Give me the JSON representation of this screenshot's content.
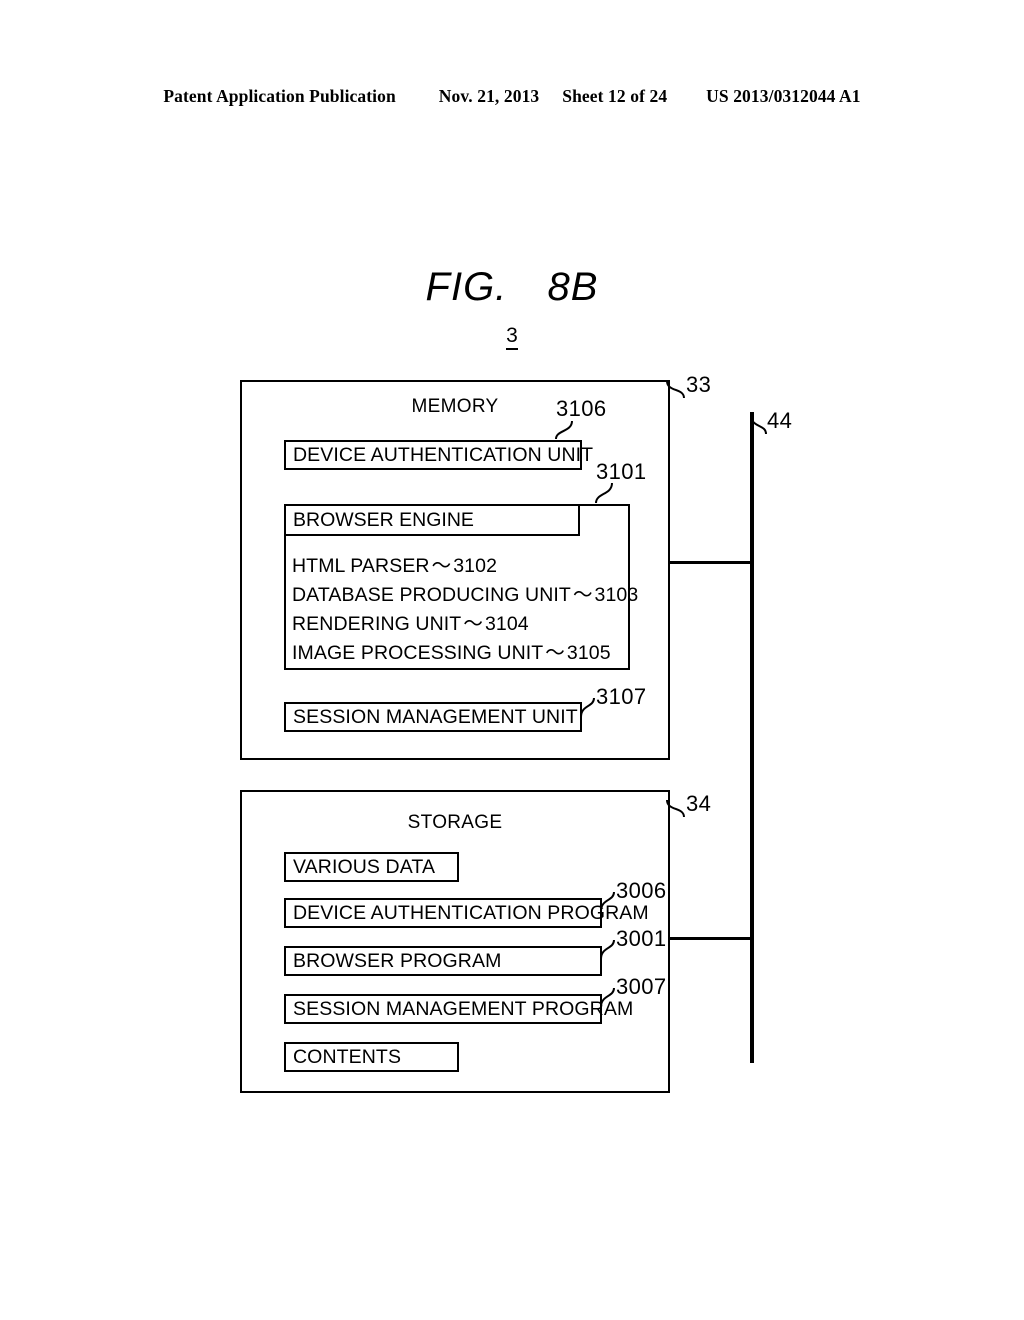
{
  "header": {
    "publication": "Patent Application Publication",
    "date": "Nov. 21, 2013",
    "sheet": "Sheet 12 of 24",
    "patent_number": "US 2013/0312044 A1"
  },
  "figure": {
    "title_prefix": "FIG.",
    "title_number": "8B",
    "device_ref": "3"
  },
  "memory": {
    "title": "MEMORY",
    "ref": "33",
    "device_auth_unit": {
      "label": "DEVICE AUTHENTICATION UNIT",
      "ref": "3106"
    },
    "browser_engine": {
      "label": "BROWSER ENGINE",
      "ref": "3101",
      "items": [
        {
          "label": "HTML PARSER",
          "tilde": "〜",
          "ref": "3102"
        },
        {
          "label": "DATABASE PRODUCING UNIT",
          "tilde": "〜",
          "ref": "3103"
        },
        {
          "label": "RENDERING UNIT",
          "tilde": "〜",
          "ref": "3104"
        },
        {
          "label": "IMAGE PROCESSING UNIT",
          "tilde": "〜",
          "ref": "3105"
        }
      ]
    },
    "session_management_unit": {
      "label": "SESSION MANAGEMENT UNIT",
      "ref": "3107"
    }
  },
  "storage": {
    "title": "STORAGE",
    "ref": "34",
    "items": [
      {
        "label": "VARIOUS DATA",
        "ref": ""
      },
      {
        "label": "DEVICE AUTHENTICATION PROGRAM",
        "ref": "3006"
      },
      {
        "label": "BROWSER PROGRAM",
        "ref": "3001"
      },
      {
        "label": "SESSION MANAGEMENT PROGRAM",
        "ref": "3007"
      },
      {
        "label": "CONTENTS",
        "ref": ""
      }
    ]
  },
  "bus": {
    "ref": "44"
  }
}
